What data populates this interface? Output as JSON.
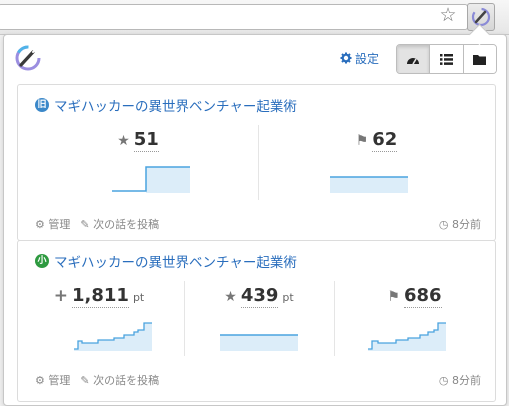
{
  "toolbar": {
    "bookmark_icon": "star-icon",
    "extension_icon": "magi-extension-icon"
  },
  "header": {
    "settings_label": "設定",
    "settings_icon": "gear-icon",
    "views": [
      "dashboard-icon",
      "list-icon",
      "folder-icon"
    ]
  },
  "cards": [
    {
      "badge": "旧",
      "badge_color": "#3b88c9",
      "title": "マギハッカーの異世界ベンチャー起業術",
      "metrics": [
        {
          "icon": "★",
          "value": "51",
          "unit": ""
        },
        {
          "icon": "⚑",
          "value": "62",
          "unit": ""
        }
      ],
      "manage_label": "管理",
      "post_label": "次の話を投稿",
      "time": "8分前"
    },
    {
      "badge": "小",
      "badge_color": "#2e9a40",
      "title": "マギハッカーの異世界ベンチャー起業術",
      "metrics": [
        {
          "icon": "+",
          "value": "1,811",
          "unit": "pt"
        },
        {
          "icon": "★",
          "value": "439",
          "unit": "pt"
        },
        {
          "icon": "⚑",
          "value": "686",
          "unit": ""
        }
      ],
      "manage_label": "管理",
      "post_label": "次の話を投稿",
      "time": "8分前"
    }
  ],
  "colors": {
    "accent": "#2a6ebd",
    "spark_line": "#4aa3df",
    "spark_fill": "#dcedf9"
  }
}
